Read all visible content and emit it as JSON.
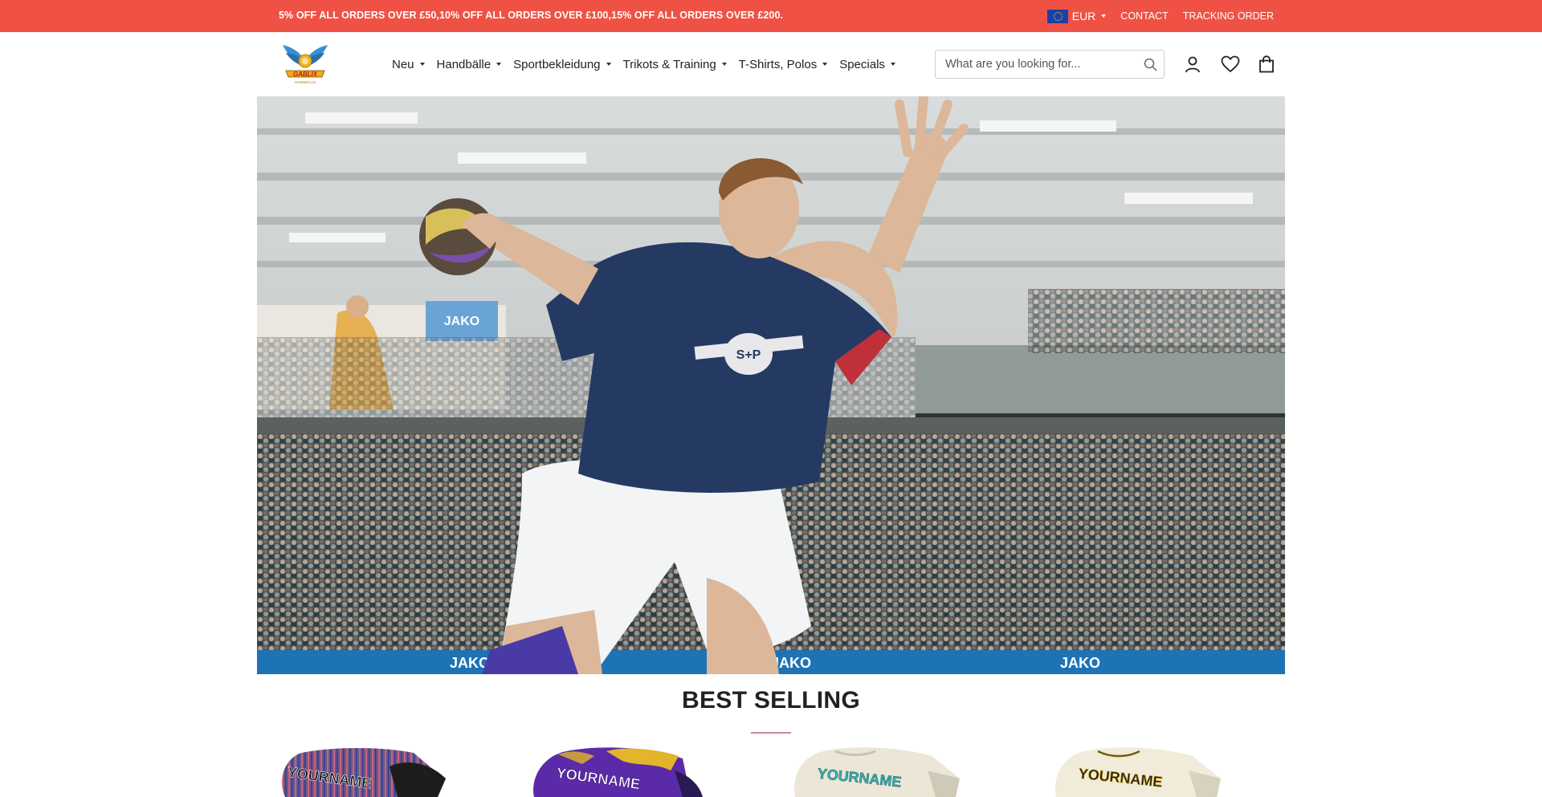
{
  "promo": {
    "text": "5% OFF ALL ORDERS OVER £50,10% OFF ALL ORDERS OVER £100,15% OFF ALL ORDERS OVER £200.",
    "currency": "EUR",
    "contact": "CONTACT",
    "tracking": "TRACKING ORDER"
  },
  "header": {
    "logo_text": "GABLIX",
    "logo_sub": "HANDBÄLLE",
    "nav": [
      {
        "label": "Neu"
      },
      {
        "label": "Handbälle"
      },
      {
        "label": "Sportbekleidung"
      },
      {
        "label": "Trikots & Training"
      },
      {
        "label": "T-Shirts, Polos"
      },
      {
        "label": "Specials"
      }
    ],
    "search_placeholder": "What are you looking for..."
  },
  "hero": {
    "shirt_print": "S+P",
    "banner_brand": "JAKO"
  },
  "best_selling": {
    "title": "BEST SELLING",
    "products": [
      {
        "print": "YOURNAME"
      },
      {
        "print": "YOURNAME"
      },
      {
        "print": "YOURNAME"
      },
      {
        "print": "YOURNAME"
      }
    ]
  },
  "colors": {
    "promo_bg": "#ef5244",
    "accent_underline": "#c98a93",
    "text": "#222222"
  },
  "icons": [
    "eu-flag-icon",
    "search-icon",
    "user-icon",
    "heart-icon",
    "bag-icon",
    "chevron-down-icon"
  ]
}
